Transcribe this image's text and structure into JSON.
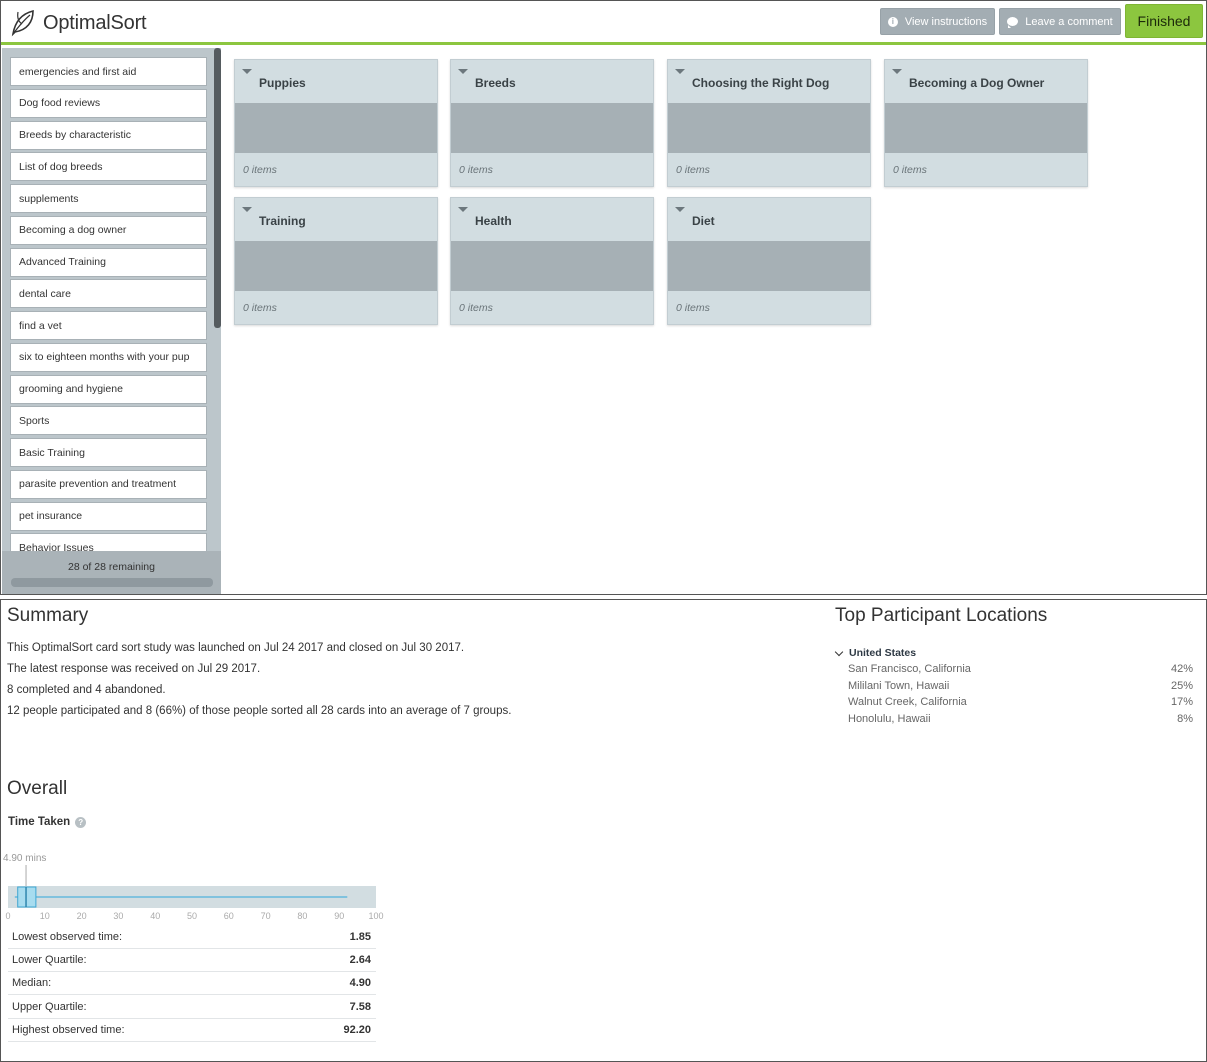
{
  "app": {
    "logo_text": "OptimalSort",
    "buttons": {
      "view_instructions": "View instructions",
      "leave_comment": "Leave a comment",
      "finished": "Finished"
    },
    "colors": {
      "accent": "#8cc63f",
      "button_gray": "#a3adb3",
      "group_bg": "#d2dde1"
    }
  },
  "sidebar": {
    "cards": [
      "emergencies and first aid",
      "Dog food reviews",
      "Breeds by characteristic",
      "List of dog breeds",
      "supplements",
      "Becoming a dog owner",
      "Advanced Training",
      "dental care",
      "find a vet",
      "six to eighteen months with your pup",
      "grooming and hygiene",
      "Sports",
      "Basic Training",
      "parasite prevention and treatment",
      "pet insurance",
      "Behavior Issues"
    ],
    "remaining": "28 of 28 remaining"
  },
  "groups": [
    {
      "title": "Puppies",
      "count": "0 items"
    },
    {
      "title": "Breeds",
      "count": "0 items"
    },
    {
      "title": "Choosing the Right Dog",
      "count": "0 items"
    },
    {
      "title": "Becoming a Dog Owner",
      "count": "0 items"
    },
    {
      "title": "Training",
      "count": "0 items"
    },
    {
      "title": "Health",
      "count": "0 items"
    },
    {
      "title": "Diet",
      "count": "0 items"
    }
  ],
  "summary": {
    "title": "Summary",
    "lines": [
      "This OptimalSort card sort study was launched on Jul 24 2017 and closed on Jul 30 2017.",
      "The latest response was received on Jul 29 2017.",
      "8 completed and 4 abandoned.",
      "12 people participated and 8 (66%) of those people sorted all 28 cards into an average of 7 groups."
    ]
  },
  "locations": {
    "title": "Top Participant Locations",
    "country": "United States",
    "items": [
      {
        "name": "San Francisco, California",
        "pct": "42%"
      },
      {
        "name": "Mililani Town, Hawaii",
        "pct": "25%"
      },
      {
        "name": "Walnut Creek, California",
        "pct": "17%"
      },
      {
        "name": "Honolulu, Hawaii",
        "pct": "8%"
      }
    ]
  },
  "overall": {
    "title": "Overall",
    "time_label": "Time Taken",
    "median_label": "4.90 mins",
    "axis_ticks": [
      0,
      10,
      20,
      30,
      40,
      50,
      60,
      70,
      80,
      90,
      100
    ],
    "axis_max": 100,
    "stats": [
      {
        "label": "Lowest observed time:",
        "value": "1.85"
      },
      {
        "label": "Lower Quartile:",
        "value": "2.64"
      },
      {
        "label": "Median:",
        "value": "4.90"
      },
      {
        "label": "Upper Quartile:",
        "value": "7.58"
      },
      {
        "label": "Highest observed time:",
        "value": "92.20"
      }
    ],
    "box": {
      "min": 1.85,
      "q1": 2.64,
      "median": 4.9,
      "q3": 7.58,
      "max": 92.2
    }
  }
}
